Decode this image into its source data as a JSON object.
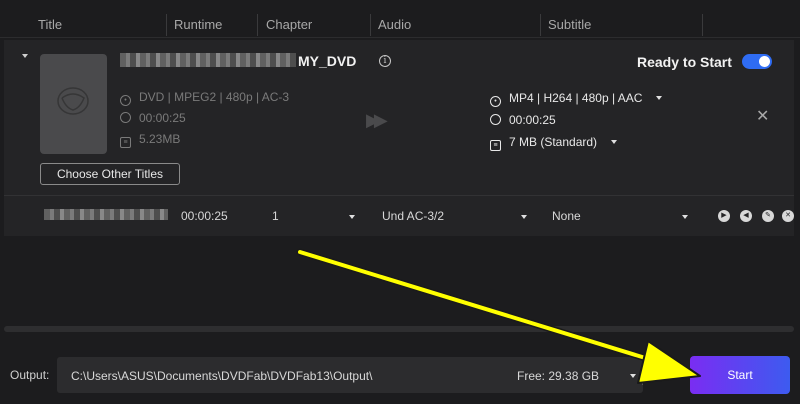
{
  "header": {
    "columns": [
      "Title",
      "Runtime",
      "Chapter",
      "Audio",
      "Subtitle"
    ]
  },
  "title_card": {
    "name": "MY_DVD",
    "status": "Ready to Start",
    "toggle_on": true,
    "source": {
      "format": "DVD | MPEG2 | 480p | AC-3",
      "duration": "00:00:25",
      "size": "5.23MB"
    },
    "target": {
      "format": "MP4 | H264 | 480p | AAC",
      "duration": "00:00:25",
      "size": "7 MB (Standard)"
    },
    "choose_button": "Choose Other Titles"
  },
  "track_row": {
    "runtime": "00:00:25",
    "chapter": "1",
    "audio": "Und  AC-3/2",
    "subtitle": "None"
  },
  "output": {
    "label": "Output:",
    "path": "C:\\Users\\ASUS\\Documents\\DVDFab\\DVDFab13\\Output\\",
    "free": "Free: 29.38 GB"
  },
  "start_button": "Start",
  "colors": {
    "accent_blue": "#2f6cf3",
    "start_gradient_left": "#7a2df2",
    "start_gradient_right": "#3d5bf0",
    "annotation_arrow": "#ffff00"
  }
}
